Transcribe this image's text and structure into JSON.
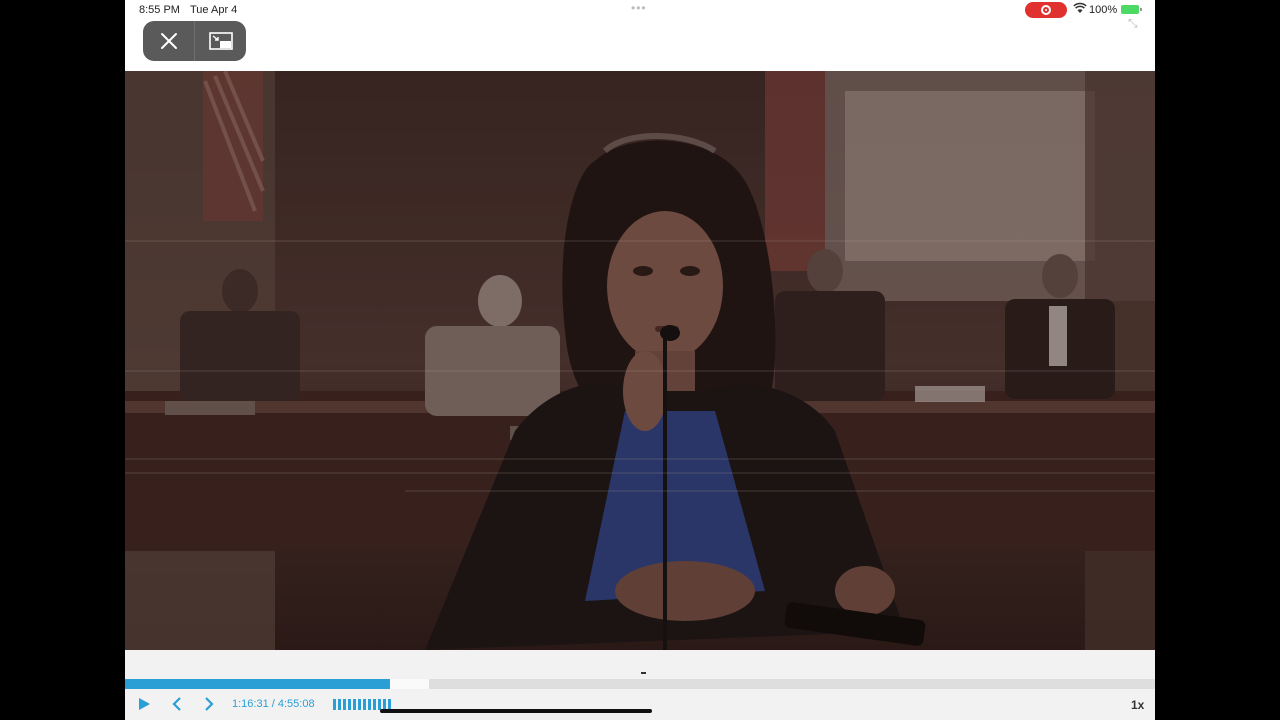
{
  "status_bar": {
    "time": "8:55 PM",
    "date": "Tue Apr 4",
    "battery": "100%",
    "record_icon": "screen-recording-icon",
    "wifi_icon": "wifi-icon",
    "battery_icon": "battery-charging-icon"
  },
  "top_controls": {
    "close_icon": "close-icon",
    "pip_icon": "picture-in-picture-icon"
  },
  "player": {
    "progress_fraction": 0.257,
    "buffered_fraction": 0.295,
    "time_label": "1:16:31 / 4:55:08",
    "speed": "1x",
    "volume_bars": 12,
    "accent_color": "#2a9fd6"
  }
}
